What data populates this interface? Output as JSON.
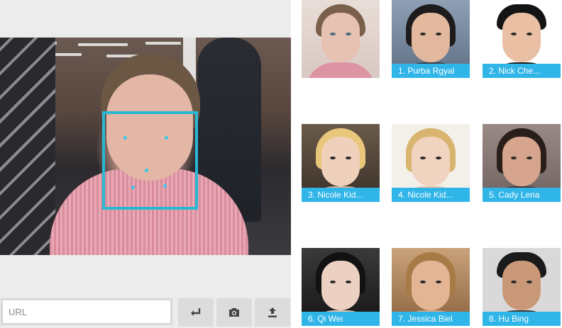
{
  "url_bar": {
    "placeholder": "URL",
    "value": ""
  },
  "buttons": [
    {
      "name": "submit-url-button",
      "icon": "return-arrow-icon"
    },
    {
      "name": "camera-button",
      "icon": "camera-icon"
    },
    {
      "name": "upload-button",
      "icon": "upload-icon"
    }
  ],
  "colors": {
    "accent": "#2fb5e8",
    "face_box": "#29b8d4",
    "panel_bg": "#ececec"
  },
  "query_face": {
    "label": ""
  },
  "matches": [
    {
      "rank_label": "1. Purba Rgyal"
    },
    {
      "rank_label": "2. Nick Che..."
    },
    {
      "rank_label": "3. Nicole Kid..."
    },
    {
      "rank_label": "4. Nicole Kid..."
    },
    {
      "rank_label": "5. Cady Lena"
    },
    {
      "rank_label": "6. Qi Wei"
    },
    {
      "rank_label": "7. Jessica Biel"
    },
    {
      "rank_label": "8. Hu Bing"
    }
  ]
}
